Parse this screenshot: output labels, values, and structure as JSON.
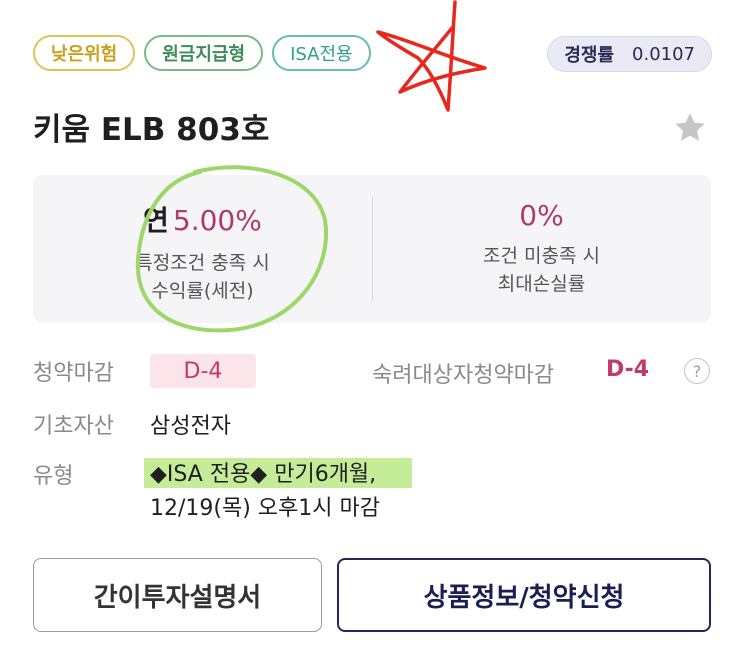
{
  "tags": [
    "낮은위험",
    "원금지급형",
    "ISA전용"
  ],
  "competition": {
    "label": "경쟁률",
    "value": "0.0107"
  },
  "product_title": "키움 ELB 803호",
  "rates": {
    "condition_met": {
      "prefix": "연",
      "value": "5.00%",
      "desc_line1": "특정조건 충족 시",
      "desc_line2": "수익률(세전)"
    },
    "condition_unmet": {
      "value": "0%",
      "desc_line1": "조건 미충족 시",
      "desc_line2": "최대손실률"
    }
  },
  "subscription_deadline": {
    "label": "청약마감",
    "value": "D-4"
  },
  "mature_investor_deadline": {
    "label": "숙려대상자청약마감",
    "value": "D-4",
    "help": "?"
  },
  "underlying_asset": {
    "label": "기초자산",
    "value": "삼성전자"
  },
  "product_type": {
    "label": "유형",
    "line1": "◆ISA 전용◆ 만기6개월,",
    "line2": "12/19(목) 오후1시 마감"
  },
  "buttons": {
    "summary": "간이투자설명서",
    "apply": "상품정보/청약신청"
  },
  "colors": {
    "accent": "#c23a6b",
    "primary_border": "#26265e",
    "highlight": "#96dc46",
    "annotation_red": "#e8281e"
  }
}
